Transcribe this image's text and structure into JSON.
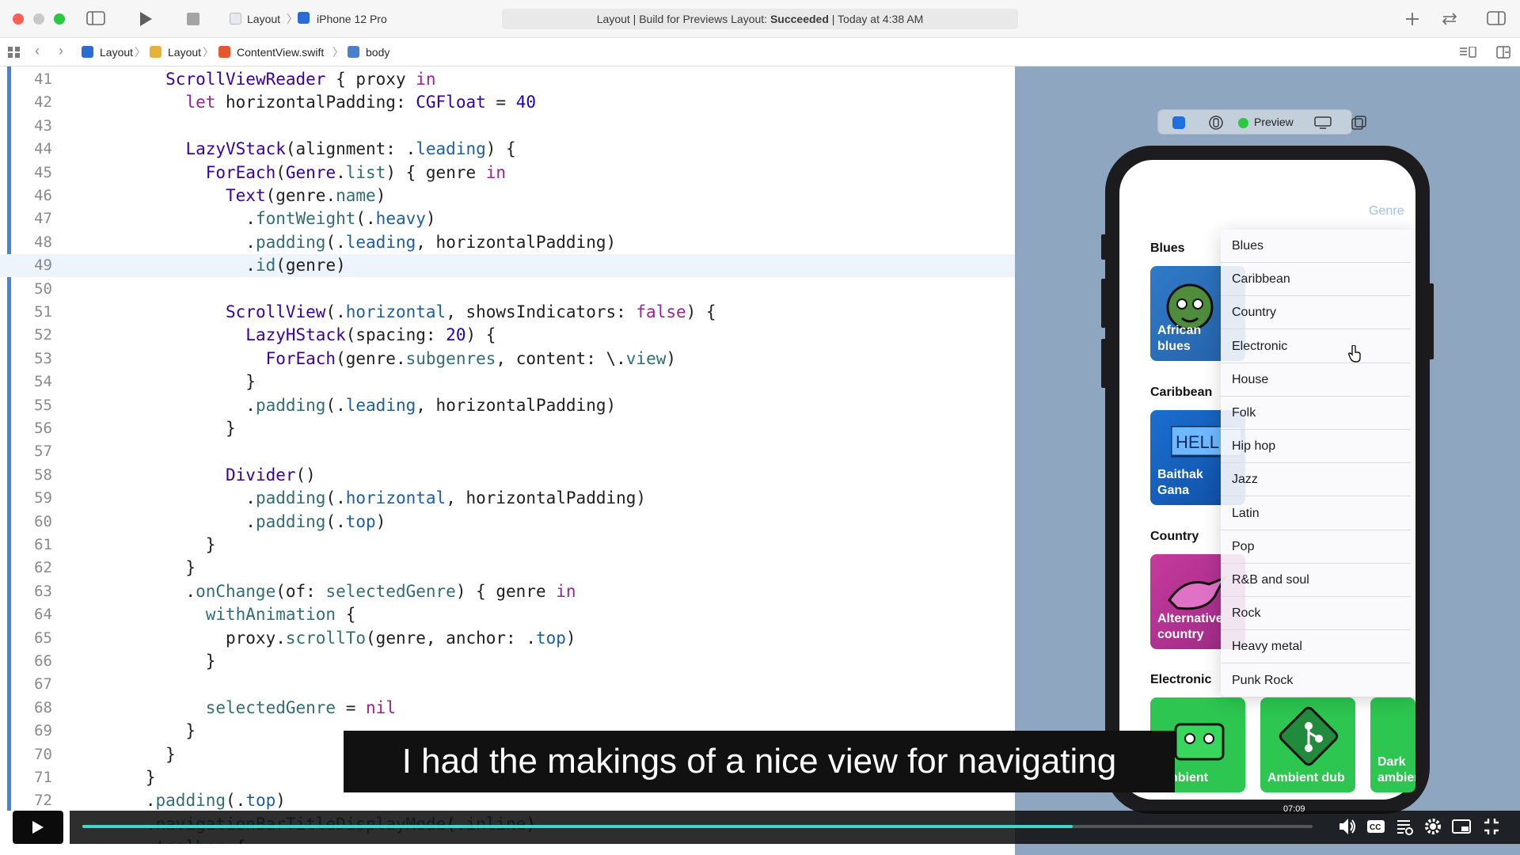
{
  "toolbar": {
    "scheme": "Layout",
    "device": "iPhone 12 Pro",
    "status_prefix": "Layout | Build for Previews Layout: ",
    "status_result": "Succeeded",
    "status_time": " | Today at 4:38 AM"
  },
  "jump_bar": {
    "items": [
      "Layout",
      "Layout",
      "ContentView.swift",
      "body"
    ]
  },
  "editor": {
    "current_line": 49,
    "lines": [
      {
        "n": "41",
        "html": "        <span class='ty'>ScrollViewReader</span> { proxy <span class='kw'>in</span>"
      },
      {
        "n": "42",
        "html": "          <span class='kw'>let</span> horizontalPadding: <span class='ty'>CGFloat</span> = <span class='num'>40</span>"
      },
      {
        "n": "43",
        "html": ""
      },
      {
        "n": "44",
        "html": "          <span class='ty'>LazyVStack</span>(alignment: .<span class='pr'>leading</span>) {"
      },
      {
        "n": "45",
        "html": "            <span class='ty'>ForEach</span>(<span class='ty'>Genre</span>.<span class='fn'>list</span>) { genre <span class='kw'>in</span>"
      },
      {
        "n": "46",
        "html": "              <span class='ty'>Text</span>(genre.<span class='fn'>name</span>)"
      },
      {
        "n": "47",
        "html": "                .<span class='fn'>fontWeight</span>(.<span class='pr'>heavy</span>)"
      },
      {
        "n": "48",
        "html": "                .<span class='fn'>padding</span>(.<span class='pr'>leading</span>, horizontalPadding)"
      },
      {
        "n": "49",
        "html": "                .<span class='fn'>id</span>(genre)"
      },
      {
        "n": "50",
        "html": ""
      },
      {
        "n": "51",
        "html": "              <span class='ty'>ScrollView</span>(.<span class='pr'>horizontal</span>, showsIndicators: <span class='kw'>false</span>) {"
      },
      {
        "n": "52",
        "html": "                <span class='ty'>LazyHStack</span>(spacing: <span class='num'>20</span>) {"
      },
      {
        "n": "53",
        "html": "                  <span class='ty'>ForEach</span>(genre.<span class='fn'>subgenres</span>, content: \\.<span class='fn'>view</span>)"
      },
      {
        "n": "54",
        "html": "                }"
      },
      {
        "n": "55",
        "html": "                .<span class='fn'>padding</span>(.<span class='pr'>leading</span>, horizontalPadding)"
      },
      {
        "n": "56",
        "html": "              }"
      },
      {
        "n": "57",
        "html": ""
      },
      {
        "n": "58",
        "html": "              <span class='ty'>Divider</span>()"
      },
      {
        "n": "59",
        "html": "                .<span class='fn'>padding</span>(.<span class='pr'>horizontal</span>, horizontalPadding)"
      },
      {
        "n": "60",
        "html": "                .<span class='fn'>padding</span>(.<span class='pr'>top</span>)"
      },
      {
        "n": "61",
        "html": "            }"
      },
      {
        "n": "62",
        "html": "          }"
      },
      {
        "n": "63",
        "html": "          .<span class='fn'>onChange</span>(of: <span class='fn'>selectedGenre</span>) { genre <span class='kw'>in</span>"
      },
      {
        "n": "64",
        "html": "            <span class='fn'>withAnimation</span> {"
      },
      {
        "n": "65",
        "html": "              proxy.<span class='fn'>scrollTo</span>(genre, anchor: .<span class='pr'>top</span>)"
      },
      {
        "n": "66",
        "html": "            }"
      },
      {
        "n": "67",
        "html": ""
      },
      {
        "n": "68",
        "html": "            <span class='fn'>selectedGenre</span> = <span class='kw'>nil</span>"
      },
      {
        "n": "69",
        "html": "          }"
      },
      {
        "n": "70",
        "html": "        }"
      },
      {
        "n": "71",
        "html": "      }"
      },
      {
        "n": "72",
        "html": "      .<span class='fn'>padding</span>(.<span class='pr'>top</span>)"
      },
      {
        "n": "73",
        "html": "      .<span class='fn'>navigationBarTitleDisplayMode</span>(.<span class='pr'>inline</span>)"
      },
      {
        "n": "74",
        "html": "      .<span class='fn'>toolbar</span> {"
      }
    ]
  },
  "preview": {
    "mode_label": "Preview",
    "nav_button": "Genre",
    "sections": [
      {
        "title": "Blues",
        "tiles": [
          "African blues"
        ]
      },
      {
        "title": "Caribbean",
        "tiles": [
          "Baithak Gana"
        ]
      },
      {
        "title": "Country",
        "tiles": [
          "Alternative country"
        ]
      },
      {
        "title": "Electronic",
        "tiles": [
          "Ambient",
          "Ambient dub",
          "Dark ambient"
        ]
      }
    ],
    "menu_items": [
      "Blues",
      "Caribbean",
      "Country",
      "Electronic",
      "House",
      "Folk",
      "Hip hop",
      "Jazz",
      "Latin",
      "Pop",
      "R&B and soul",
      "Rock",
      "Heavy metal",
      "Punk Rock"
    ]
  },
  "caption": "I had the makings of a nice view for navigating",
  "player": {
    "time": "07:09",
    "progress_fraction": 0.805
  },
  "colors": {
    "progress": "#3bd9c9",
    "keyword": "#9b2393",
    "type": "#3900a0"
  }
}
